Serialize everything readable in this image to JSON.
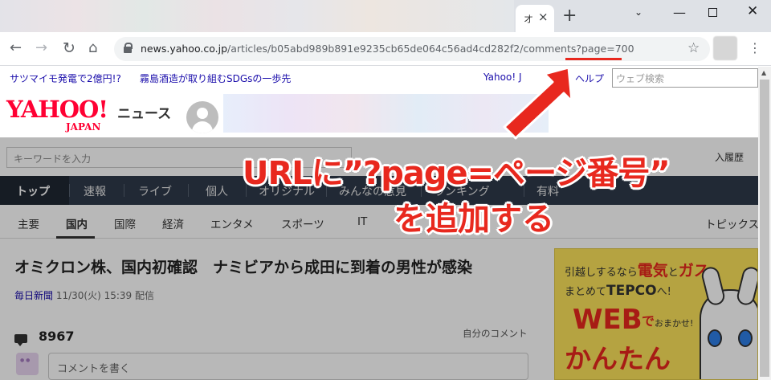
{
  "browser": {
    "tab_title": "オ",
    "tab_close": "×",
    "new_tab": "+",
    "url_host": "news.yahoo.co.jp",
    "url_path": "/articles/b05abd989b891e9235cb65de064c56ad4cd282f2/comments?page=700",
    "star": "☆",
    "menu": "⋮",
    "back": "←",
    "forward": "→",
    "reload": "↻",
    "home": "⌂",
    "window": {
      "chevron": "⌄",
      "minimize": "—",
      "close": "✕"
    }
  },
  "page": {
    "topbar": {
      "link1": "サツマイモ発電で2億円!?",
      "link2": "霧島酒造が取り組むSDGsの一歩先",
      "yahoo": "Yahoo! J",
      "help": "ヘルプ",
      "search_placeholder": "ウェブ検索"
    },
    "logo": {
      "yahoo": "YAHOO!",
      "japan": "JAPAN",
      "news": "ニュース"
    },
    "keyword_placeholder": "キーワードを入力",
    "history": "入履歴",
    "nav": [
      "トップ",
      "速報",
      "ライブ",
      "個人",
      "オリジナル",
      "みんなの意見",
      "ランキング",
      "有料"
    ],
    "subnav": [
      "主要",
      "国内",
      "国際",
      "経済",
      "エンタメ",
      "スポーツ",
      "IT"
    ],
    "topics": "トピックス",
    "article": {
      "headline": "オミクロン株、国内初確認　ナミビアから成田に到着の男性が感染",
      "publisher": "毎日新聞",
      "date": "11/30(火) 15:39 配信"
    },
    "comments": {
      "count": "8967",
      "my_comments": "自分のコメント",
      "input_placeholder": "コメントを書く"
    },
    "ad": {
      "line1_a": "引越しするなら",
      "line1_b": "電気",
      "line1_c": "と",
      "line1_d": "ガス",
      "line2": "まとめて",
      "line2_b": "TEPCO",
      "line2_c": "へ!",
      "web": "WEB",
      "de": "で",
      "omakase": "おまかせ!",
      "kantan": "かんたん"
    }
  },
  "annotation": {
    "line1": "URLに”?page=ページ番号”",
    "line2": "を追加する",
    "color": "#e8281e"
  }
}
